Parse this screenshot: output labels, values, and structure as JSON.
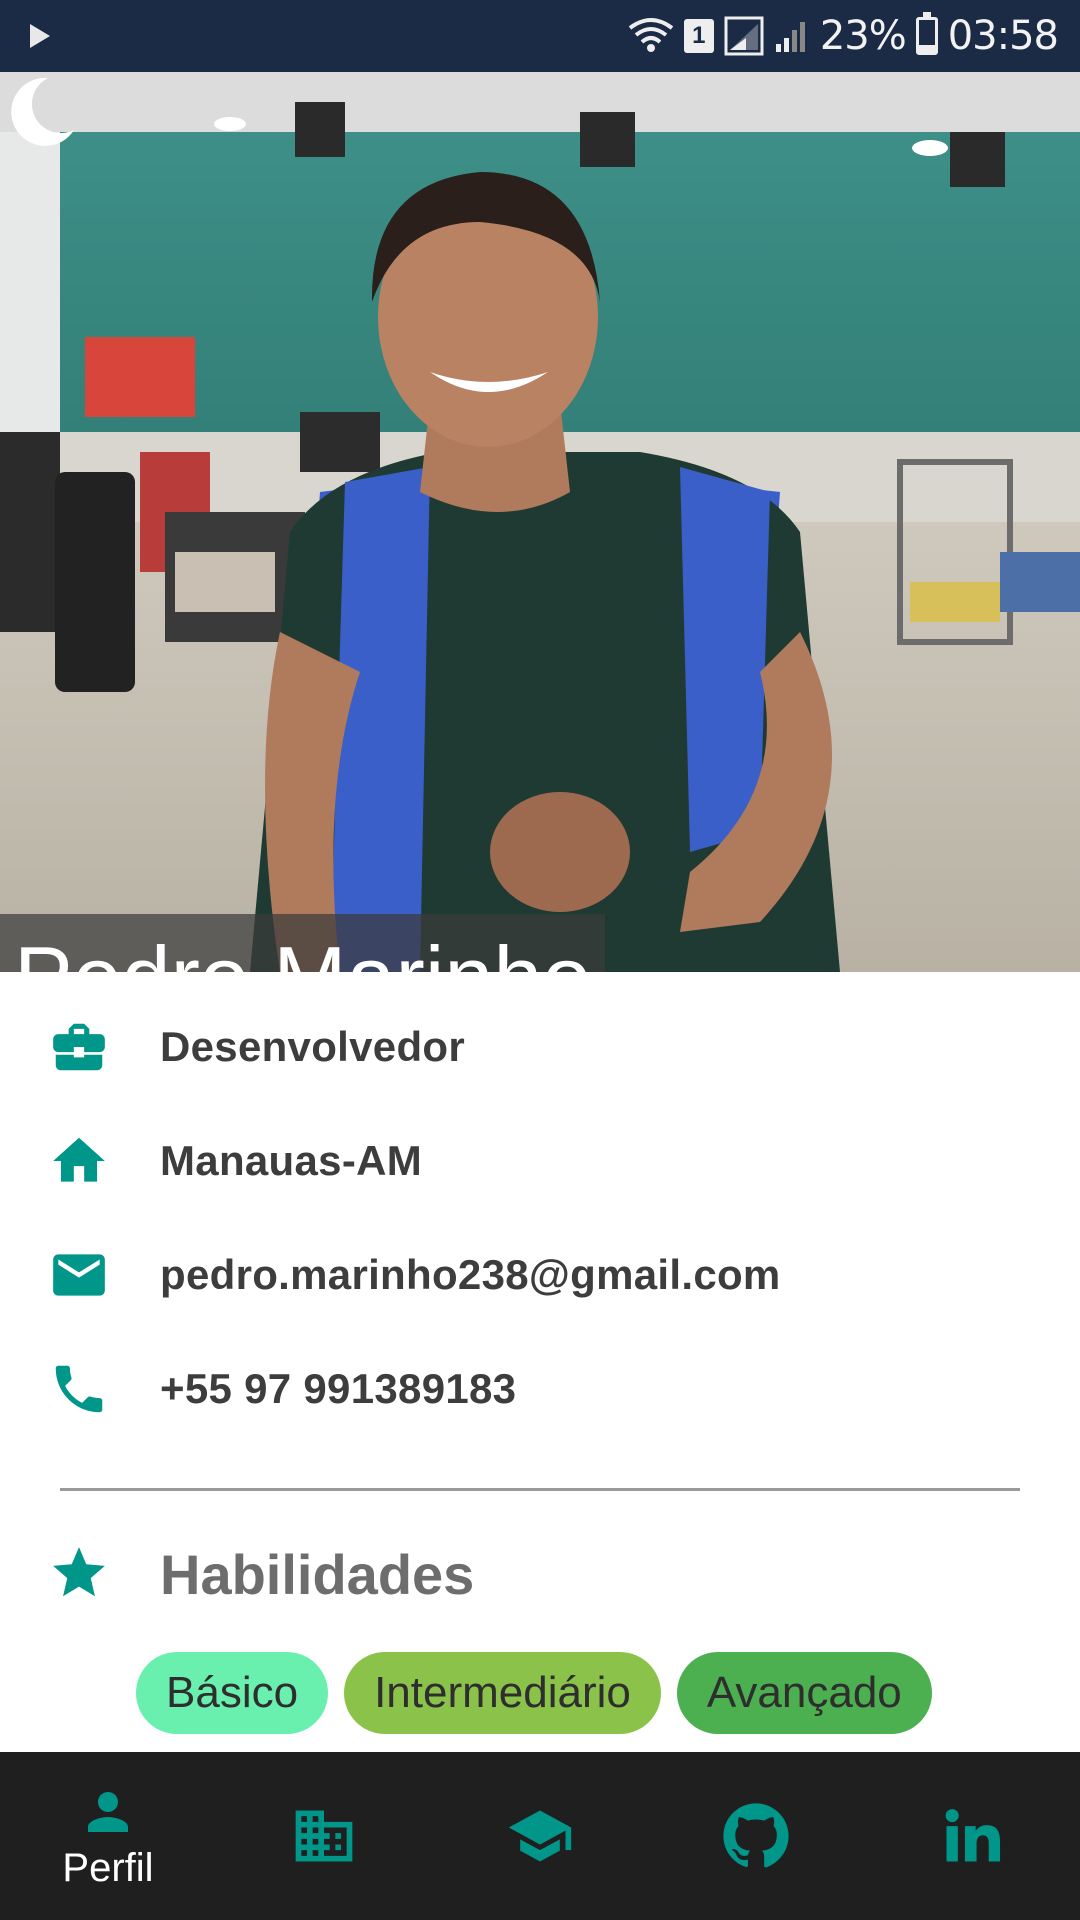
{
  "status_bar": {
    "battery": "23%",
    "battery_level": 0.23,
    "time": "03:58",
    "sim_slot": "1"
  },
  "profile": {
    "name": "Pedro Marinho",
    "info": [
      {
        "icon": "briefcase-icon",
        "text": "Desenvolvedor"
      },
      {
        "icon": "home-icon",
        "text": "Manauas-AM"
      },
      {
        "icon": "email-icon",
        "text": "pedro.marinho238@gmail.com"
      },
      {
        "icon": "phone-icon",
        "text": "+55 97 991389183"
      }
    ]
  },
  "skills": {
    "title": "Habilidades",
    "levels": [
      {
        "label": "Básico",
        "color": "#69f0ae"
      },
      {
        "label": "Intermediário",
        "color": "#8bc34a"
      },
      {
        "label": "Avançado",
        "color": "#4caf50"
      }
    ]
  },
  "bottom_nav": {
    "items": [
      {
        "icon": "person-icon",
        "label": "Perfil",
        "active": true
      },
      {
        "icon": "building-icon",
        "label": ""
      },
      {
        "icon": "graduation-cap-icon",
        "label": ""
      },
      {
        "icon": "github-icon",
        "label": ""
      },
      {
        "icon": "linkedin-icon",
        "label": ""
      }
    ]
  },
  "colors": {
    "accent": "#00968a",
    "status_bar": "#1b2a45",
    "nav_bg": "#1f1f1f"
  }
}
